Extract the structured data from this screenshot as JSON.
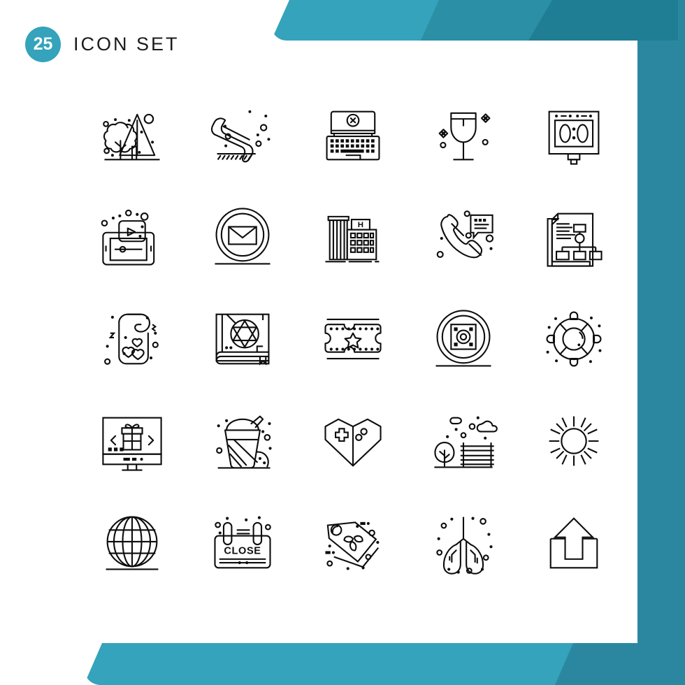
{
  "header": {
    "count": "25",
    "title": "ICON SET",
    "badge_color": "#34a3bb",
    "title_color": "#1b1b1b"
  },
  "theme": {
    "background": "#ffffff",
    "accent_light": "#34a3bb",
    "accent_mid": "#2b8fa6",
    "accent_dark": "#1f7e93",
    "accent_slab": "#2b87a0",
    "icon_stroke": "#0d0d0d"
  },
  "grid": {
    "columns": 5,
    "rows": 5,
    "total_icons": 25
  },
  "icons": [
    {
      "index": 1,
      "row": 1,
      "col": 1,
      "name": "tree-mountain-icon",
      "label": "Tree and mountain landscape"
    },
    {
      "index": 2,
      "row": 1,
      "col": 2,
      "name": "phone-handset-icon",
      "label": "Telephone handset"
    },
    {
      "index": 3,
      "row": 1,
      "col": 3,
      "name": "laptop-error-icon",
      "label": "Laptop with error cross"
    },
    {
      "index": 4,
      "row": 1,
      "col": 4,
      "name": "wine-glass-icon",
      "label": "Wine glass"
    },
    {
      "index": 5,
      "row": 1,
      "col": 5,
      "name": "scoreboard-icon",
      "label": "Digital scoreboard clock",
      "display_text": "0:0"
    },
    {
      "index": 6,
      "row": 2,
      "col": 1,
      "name": "tablet-video-icon",
      "label": "Tablet video player"
    },
    {
      "index": 7,
      "row": 2,
      "col": 2,
      "name": "email-circle-icon",
      "label": "Envelope in circle"
    },
    {
      "index": 8,
      "row": 2,
      "col": 3,
      "name": "hotel-building-icon",
      "label": "Hotel building",
      "display_text": "H"
    },
    {
      "index": 9,
      "row": 2,
      "col": 4,
      "name": "phone-chat-icon",
      "label": "Phone with chat bubble"
    },
    {
      "index": 10,
      "row": 2,
      "col": 5,
      "name": "documents-flowchart-icon",
      "label": "Documents with flowchart"
    },
    {
      "index": 11,
      "row": 3,
      "col": 1,
      "name": "door-hanger-hearts-icon",
      "label": "Door hanger with hearts"
    },
    {
      "index": 12,
      "row": 3,
      "col": 2,
      "name": "magic-book-icon",
      "label": "Book with pentagram"
    },
    {
      "index": 13,
      "row": 3,
      "col": 3,
      "name": "ticket-star-icon",
      "label": "Ticket with star"
    },
    {
      "index": 14,
      "row": 3,
      "col": 4,
      "name": "film-reel-icon",
      "label": "Film reel in circle"
    },
    {
      "index": 15,
      "row": 3,
      "col": 5,
      "name": "lifebuoy-icon",
      "label": "Lifebuoy ring"
    },
    {
      "index": 16,
      "row": 4,
      "col": 1,
      "name": "online-gift-monitor-icon",
      "label": "Monitor with gift box"
    },
    {
      "index": 17,
      "row": 4,
      "col": 2,
      "name": "milkshake-icon",
      "label": "Milkshake cup with straw"
    },
    {
      "index": 18,
      "row": 4,
      "col": 3,
      "name": "heart-gamepad-icon",
      "label": "Heart shaped gamepad"
    },
    {
      "index": 19,
      "row": 4,
      "col": 4,
      "name": "park-bench-icon",
      "label": "Park with tree and bench"
    },
    {
      "index": 20,
      "row": 4,
      "col": 5,
      "name": "sun-icon",
      "label": "Sun"
    },
    {
      "index": 21,
      "row": 5,
      "col": 1,
      "name": "globe-icon",
      "label": "Globe wireframe"
    },
    {
      "index": 22,
      "row": 5,
      "col": 2,
      "name": "close-sign-icon",
      "label": "Hanging close sign",
      "display_text": "CLOSE"
    },
    {
      "index": 23,
      "row": 5,
      "col": 3,
      "name": "eco-tag-icon",
      "label": "Eco leaf price tag"
    },
    {
      "index": 24,
      "row": 5,
      "col": 4,
      "name": "lungs-icon",
      "label": "Lungs"
    },
    {
      "index": 25,
      "row": 5,
      "col": 5,
      "name": "upload-icon",
      "label": "Upload arrow out of tray"
    }
  ]
}
